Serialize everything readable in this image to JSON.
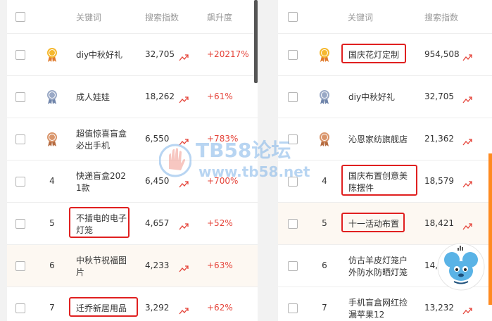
{
  "left_table": {
    "headers": {
      "keyword": "关键词",
      "search_index": "搜索指数",
      "rise": "飙升度"
    },
    "rows": [
      {
        "rank": "1",
        "rank_icon": "gold-medal",
        "keyword": [
          "diy中秋好礼"
        ],
        "search": "32,705",
        "rise": "+20217%"
      },
      {
        "rank": "2",
        "rank_icon": "silver-medal",
        "keyword": [
          "成人娃娃"
        ],
        "search": "18,262",
        "rise": "+61%"
      },
      {
        "rank": "3",
        "rank_icon": "bronze-medal",
        "keyword": [
          "超值惊喜盲盒",
          "必出手机"
        ],
        "search": "6,550",
        "rise": "+783%"
      },
      {
        "rank": "4",
        "keyword": [
          "快递盲盒202",
          "1款"
        ],
        "search": "6,450",
        "rise": "+700%"
      },
      {
        "rank": "5",
        "keyword": [
          "不插电的电子",
          "灯笼"
        ],
        "search": "4,657",
        "rise": "+52%",
        "highlight": true
      },
      {
        "rank": "6",
        "keyword": [
          "中秋节祝福图",
          "片"
        ],
        "search": "4,233",
        "rise": "+63%"
      },
      {
        "rank": "7",
        "keyword": [
          "迁乔新居用品"
        ],
        "search": "3,292",
        "rise": "+62%",
        "highlight": true
      }
    ]
  },
  "right_table": {
    "headers": {
      "keyword": "关键词",
      "search_index": "搜索指数"
    },
    "rows": [
      {
        "rank": "1",
        "rank_icon": "gold-medal",
        "keyword": [
          "国庆花灯定制"
        ],
        "search": "954,508",
        "highlight": true
      },
      {
        "rank": "2",
        "rank_icon": "silver-medal",
        "keyword": [
          "diy中秋好礼"
        ],
        "search": "32,705"
      },
      {
        "rank": "3",
        "rank_icon": "bronze-medal",
        "keyword": [
          "沁恩家纺旗舰店"
        ],
        "search": "21,362"
      },
      {
        "rank": "4",
        "keyword": [
          "国庆布置创意美",
          "陈摆件"
        ],
        "search": "18,579",
        "highlight": true
      },
      {
        "rank": "5",
        "keyword": [
          "十一活动布置"
        ],
        "search": "18,421",
        "highlight": true
      },
      {
        "rank": "6",
        "keyword": [
          "仿古羊皮灯笼户",
          "外防水防晒灯笼"
        ],
        "search": "14,5"
      },
      {
        "rank": "7",
        "keyword": [
          "手机盲盒网红捡",
          "漏苹果12"
        ],
        "search": "13,232"
      }
    ]
  },
  "watermark": {
    "line1": "TB58论坛",
    "line2": "www.tb58.net"
  },
  "colors": {
    "rise": "#e5443a",
    "highlight_box": "#e02020",
    "gold": "#f5b82e",
    "silver": "#9aa9c6",
    "bronze": "#d9956b"
  }
}
